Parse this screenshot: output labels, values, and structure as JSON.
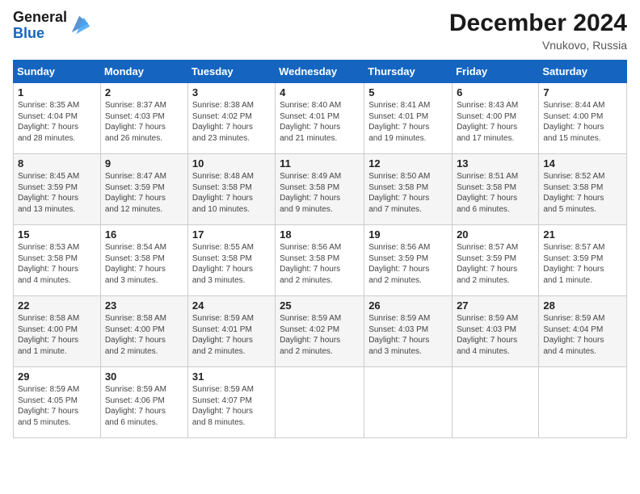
{
  "header": {
    "logo_line1": "General",
    "logo_line2": "Blue",
    "month_title": "December 2024",
    "location": "Vnukovo, Russia"
  },
  "days_of_week": [
    "Sunday",
    "Monday",
    "Tuesday",
    "Wednesday",
    "Thursday",
    "Friday",
    "Saturday"
  ],
  "weeks": [
    [
      {
        "num": "1",
        "sunrise": "8:35 AM",
        "sunset": "4:04 PM",
        "daylight": "7 hours and 28 minutes."
      },
      {
        "num": "2",
        "sunrise": "8:37 AM",
        "sunset": "4:03 PM",
        "daylight": "7 hours and 26 minutes."
      },
      {
        "num": "3",
        "sunrise": "8:38 AM",
        "sunset": "4:02 PM",
        "daylight": "7 hours and 23 minutes."
      },
      {
        "num": "4",
        "sunrise": "8:40 AM",
        "sunset": "4:01 PM",
        "daylight": "7 hours and 21 minutes."
      },
      {
        "num": "5",
        "sunrise": "8:41 AM",
        "sunset": "4:01 PM",
        "daylight": "7 hours and 19 minutes."
      },
      {
        "num": "6",
        "sunrise": "8:43 AM",
        "sunset": "4:00 PM",
        "daylight": "7 hours and 17 minutes."
      },
      {
        "num": "7",
        "sunrise": "8:44 AM",
        "sunset": "4:00 PM",
        "daylight": "7 hours and 15 minutes."
      }
    ],
    [
      {
        "num": "8",
        "sunrise": "8:45 AM",
        "sunset": "3:59 PM",
        "daylight": "7 hours and 13 minutes."
      },
      {
        "num": "9",
        "sunrise": "8:47 AM",
        "sunset": "3:59 PM",
        "daylight": "7 hours and 12 minutes."
      },
      {
        "num": "10",
        "sunrise": "8:48 AM",
        "sunset": "3:58 PM",
        "daylight": "7 hours and 10 minutes."
      },
      {
        "num": "11",
        "sunrise": "8:49 AM",
        "sunset": "3:58 PM",
        "daylight": "7 hours and 9 minutes."
      },
      {
        "num": "12",
        "sunrise": "8:50 AM",
        "sunset": "3:58 PM",
        "daylight": "7 hours and 7 minutes."
      },
      {
        "num": "13",
        "sunrise": "8:51 AM",
        "sunset": "3:58 PM",
        "daylight": "7 hours and 6 minutes."
      },
      {
        "num": "14",
        "sunrise": "8:52 AM",
        "sunset": "3:58 PM",
        "daylight": "7 hours and 5 minutes."
      }
    ],
    [
      {
        "num": "15",
        "sunrise": "8:53 AM",
        "sunset": "3:58 PM",
        "daylight": "7 hours and 4 minutes."
      },
      {
        "num": "16",
        "sunrise": "8:54 AM",
        "sunset": "3:58 PM",
        "daylight": "7 hours and 3 minutes."
      },
      {
        "num": "17",
        "sunrise": "8:55 AM",
        "sunset": "3:58 PM",
        "daylight": "7 hours and 3 minutes."
      },
      {
        "num": "18",
        "sunrise": "8:56 AM",
        "sunset": "3:58 PM",
        "daylight": "7 hours and 2 minutes."
      },
      {
        "num": "19",
        "sunrise": "8:56 AM",
        "sunset": "3:59 PM",
        "daylight": "7 hours and 2 minutes."
      },
      {
        "num": "20",
        "sunrise": "8:57 AM",
        "sunset": "3:59 PM",
        "daylight": "7 hours and 2 minutes."
      },
      {
        "num": "21",
        "sunrise": "8:57 AM",
        "sunset": "3:59 PM",
        "daylight": "7 hours and 1 minute."
      }
    ],
    [
      {
        "num": "22",
        "sunrise": "8:58 AM",
        "sunset": "4:00 PM",
        "daylight": "7 hours and 1 minute."
      },
      {
        "num": "23",
        "sunrise": "8:58 AM",
        "sunset": "4:00 PM",
        "daylight": "7 hours and 2 minutes."
      },
      {
        "num": "24",
        "sunrise": "8:59 AM",
        "sunset": "4:01 PM",
        "daylight": "7 hours and 2 minutes."
      },
      {
        "num": "25",
        "sunrise": "8:59 AM",
        "sunset": "4:02 PM",
        "daylight": "7 hours and 2 minutes."
      },
      {
        "num": "26",
        "sunrise": "8:59 AM",
        "sunset": "4:03 PM",
        "daylight": "7 hours and 3 minutes."
      },
      {
        "num": "27",
        "sunrise": "8:59 AM",
        "sunset": "4:03 PM",
        "daylight": "7 hours and 4 minutes."
      },
      {
        "num": "28",
        "sunrise": "8:59 AM",
        "sunset": "4:04 PM",
        "daylight": "7 hours and 4 minutes."
      }
    ],
    [
      {
        "num": "29",
        "sunrise": "8:59 AM",
        "sunset": "4:05 PM",
        "daylight": "7 hours and 5 minutes."
      },
      {
        "num": "30",
        "sunrise": "8:59 AM",
        "sunset": "4:06 PM",
        "daylight": "7 hours and 6 minutes."
      },
      {
        "num": "31",
        "sunrise": "8:59 AM",
        "sunset": "4:07 PM",
        "daylight": "7 hours and 8 minutes."
      },
      null,
      null,
      null,
      null
    ]
  ]
}
